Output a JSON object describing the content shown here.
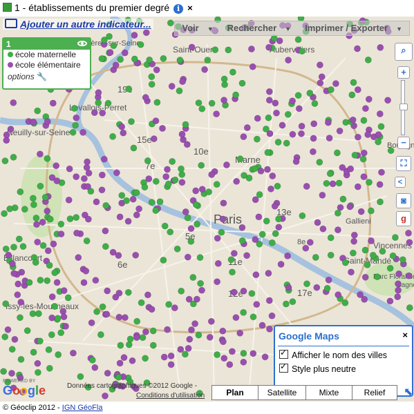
{
  "header": {
    "title": "1 - établissements du premier degré",
    "info_icon": "info-icon",
    "close_icon": "close-icon"
  },
  "toolbar": {
    "add_indicator": "Ajouter un autre indicateur...",
    "view": "Voir",
    "search": "Rechercher",
    "print_export": "Imprimer / Exporter"
  },
  "legend": {
    "number": "1",
    "items": [
      {
        "label": "école maternelle",
        "color": "#3fae49"
      },
      {
        "label": "école élémentaire",
        "color": "#9a4fb0"
      }
    ],
    "options": "options"
  },
  "map": {
    "place_labels": [
      "Asnières-sur-Seine",
      "Saint-Ouen",
      "Aubervilliers",
      "Levallois-Perret",
      "Neuilly-sur-Seine",
      "Paris",
      "Vincennes",
      "Saint-Mandé",
      "Issy-les-Moulineaux",
      "Billancourt",
      "Parc Floral de Paris",
      "Bagnolet",
      "Gallieni",
      "8e",
      "7e",
      "15e",
      "6e",
      "5e",
      "11e",
      "13e",
      "12e",
      "17e",
      "19e",
      "10e",
      "Marne",
      "Boulogne-Billancourt"
    ],
    "attribution": "Données cartographiques ©2012 Google -",
    "terms": "Conditions d'utilisation",
    "powered_by": "POWERED BY",
    "google": "Google"
  },
  "google_maps_box": {
    "title": "Google Maps",
    "option1": "Afficher le nom des villes",
    "option2": "Style plus neutre"
  },
  "map_types": [
    "Plan",
    "Satellite",
    "Mixte",
    "Relief"
  ],
  "footer": {
    "copyright": "© Géoclip 2012 - ",
    "link": "IGN GéoFla"
  },
  "colors": {
    "maternelle": "#3fae49",
    "elementaire": "#9a4fb0",
    "accent": "#2b6fd0",
    "legend_green": "#4caf50"
  }
}
